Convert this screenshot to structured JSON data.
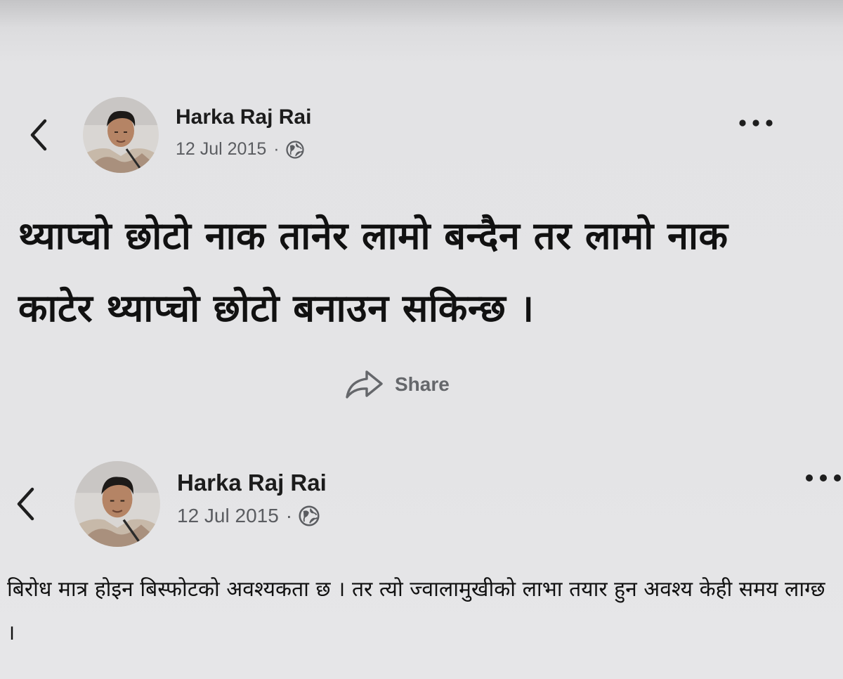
{
  "posts": [
    {
      "author": "Harka Raj Rai",
      "date": "12 Jul 2015",
      "separator": "·",
      "audience_icon": "globe-icon",
      "text": "थ्याप्चो छोटो नाक तानेर लामो बन्दैन तर लामो नाक काटेर थ्याप्चो छोटो बनाउन सकिन्छ ।",
      "share_label": "Share"
    },
    {
      "author": "Harka Raj Rai",
      "date": "12 Jul 2015",
      "separator": "·",
      "audience_icon": "globe-icon",
      "text": "बिरोध मात्र होइन बिस्फोटको अवश्यकता छ । तर त्यो ज्वालामुखीको लाभा तयार हुन अवश्य केही समय लाग्छ ।"
    }
  ],
  "icons": {
    "back": "chevron-left-icon",
    "more": "more-horizontal-icon",
    "share": "share-arrow-icon"
  },
  "colors": {
    "background": "#e4e4e6",
    "meta_text": "#5b5d61",
    "share_text": "#65676b"
  }
}
